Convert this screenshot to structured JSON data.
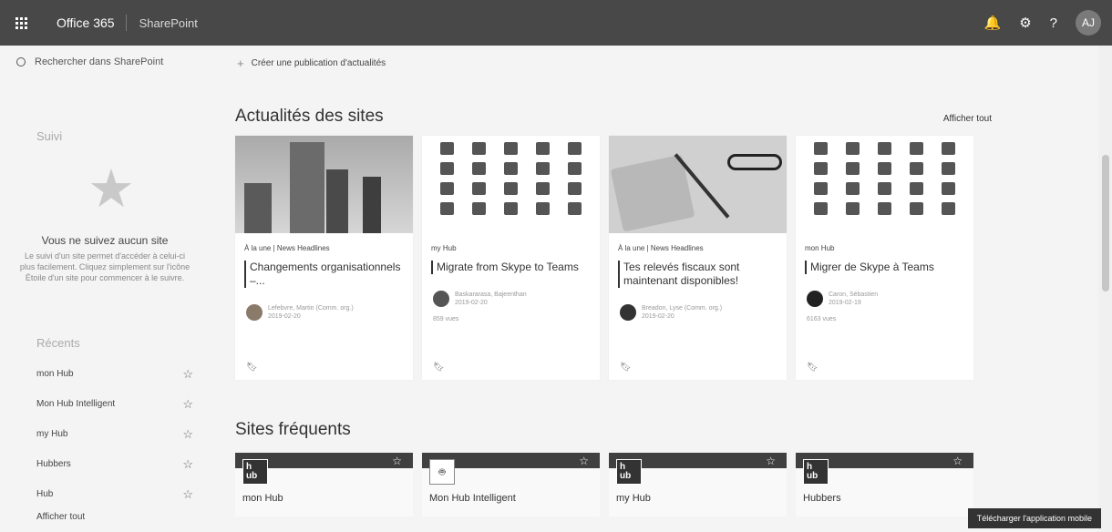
{
  "topbar": {
    "brand": "Office 365",
    "app": "SharePoint",
    "avatar_initials": "AJ",
    "icons": [
      "waffle-icon",
      "bell-icon",
      "settings-icon",
      "help-icon"
    ]
  },
  "sidebar": {
    "search_placeholder": "Rechercher dans SharePoint",
    "follow_title": "Suivi",
    "empty_title": "Vous ne suivez aucun site",
    "empty_description": "Le suivi d'un site permet d'accéder à celui-ci plus facilement. Cliquez simplement sur l'icône Étoile d'un site pour commencer à le suivre.",
    "recent_title": "Récents",
    "recent_items": [
      "mon Hub",
      "Mon Hub Intelligent",
      "my Hub",
      "Hubbers",
      "Hub"
    ],
    "see_all": "Afficher tout"
  },
  "main": {
    "create_news": "Créer une publication d'actualités",
    "news_title_prefix": "Actualités",
    "news_title_suffix": " des sites",
    "news_see_all": "Afficher tout",
    "news": [
      {
        "category": "À la une | News Headlines",
        "title": "Changements organisationnels –...",
        "author": "Lefebvre, Martin (Comm. org.)",
        "date": "2019-02-20",
        "views": "",
        "thumb": "building"
      },
      {
        "category": "my Hub",
        "title": "Migrate from Skype to Teams",
        "author": "Baskararasa, Bajeenthan",
        "date": "2019-02-20",
        "views": "859 vues",
        "thumb": "pattern"
      },
      {
        "category": "À la une | News Headlines",
        "title": "Tes relevés fiscaux sont maintenant disponibles!",
        "author": "Breadon, Lyse (Comm. org.)",
        "date": "2019-02-20",
        "views": "",
        "thumb": "calculator"
      },
      {
        "category": "mon Hub",
        "title": "Migrer de Skype à Teams",
        "author": "Caron, Sébastien",
        "date": "2019-02-19",
        "views": "6163 vues",
        "thumb": "pattern"
      }
    ],
    "sites_title_prefix": "Sites",
    "sites_title_suffix": " fréquents",
    "sites": [
      {
        "name": "mon Hub",
        "logo": "h\nub"
      },
      {
        "name": "Mon Hub Intelligent",
        "logo": ""
      },
      {
        "name": "my Hub",
        "logo": "h\nub"
      },
      {
        "name": "Hubbers",
        "logo": "h\nub"
      }
    ]
  },
  "download_button": "Télécharger l'application mobile"
}
